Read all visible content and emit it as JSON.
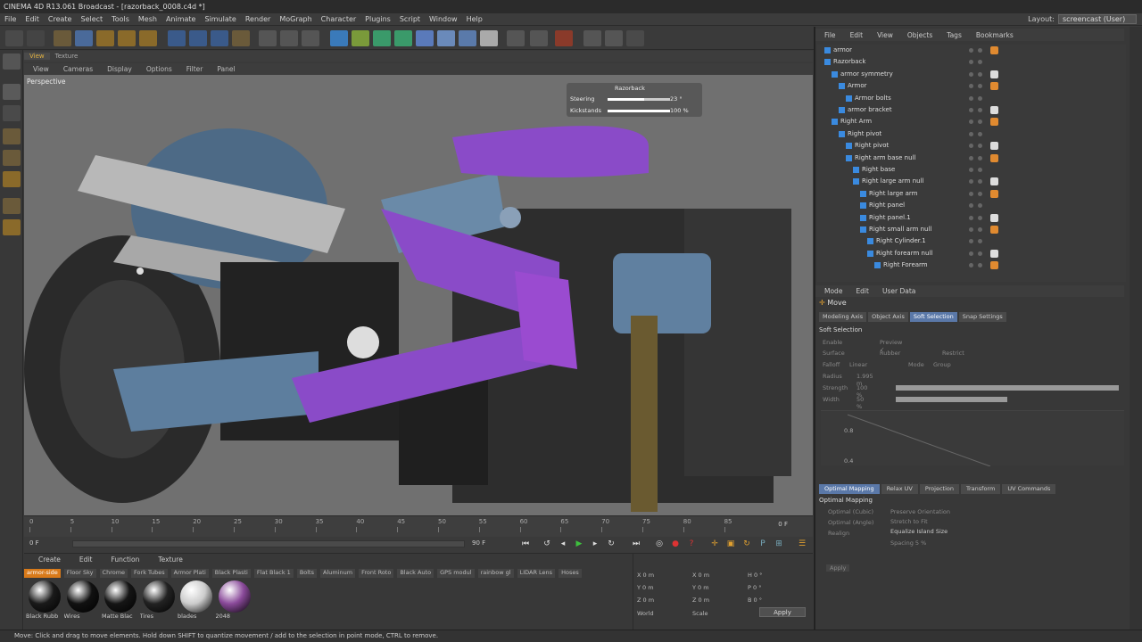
{
  "app": {
    "title": "CINEMA 4D R13.061 Broadcast - [razorback_0008.c4d *]"
  },
  "menubar": [
    "File",
    "Edit",
    "Create",
    "Select",
    "Tools",
    "Mesh",
    "Animate",
    "Simulate",
    "Render",
    "MoGraph",
    "Character",
    "Plugins",
    "Script",
    "Window",
    "Help"
  ],
  "layout": {
    "label": "Layout:",
    "value": "screencast (User)"
  },
  "viewport": {
    "tabs": [
      "View",
      "Texture"
    ],
    "menu": [
      "View",
      "Cameras",
      "Display",
      "Options",
      "Filter",
      "Panel"
    ],
    "label": "Perspective",
    "hud": {
      "name": "Razorback",
      "rows": [
        {
          "label": "Steering",
          "value": "23 °",
          "fill": 0.58
        },
        {
          "label": "Kickstands",
          "value": "100 %",
          "fill": 1.0
        }
      ]
    }
  },
  "timeline": {
    "ticks": [
      "0",
      "5",
      "10",
      "15",
      "20",
      "25",
      "30",
      "35",
      "40",
      "45",
      "50",
      "55",
      "60",
      "65",
      "70",
      "75",
      "80",
      "85"
    ],
    "current": "0 F",
    "start": "0 F",
    "end": "90 F"
  },
  "materials": {
    "menu": [
      "Create",
      "Edit",
      "Function",
      "Texture"
    ],
    "tabs": [
      "armor-side",
      "Floor Sky",
      "Chrome",
      "Fork Tubes",
      "Armor Plati",
      "Black Plasti",
      "Flat Black 1",
      "Bolts",
      "Aluminum",
      "Front Roto",
      "Black Auto",
      "GPS modul",
      "rainbow gl",
      "LIDAR Lens",
      "Hoses"
    ],
    "active_tab": "armor-side",
    "items": [
      {
        "label": "Black Rubb",
        "color": "#1a1a1a"
      },
      {
        "label": "Wires",
        "color": "#111111"
      },
      {
        "label": "Matte Blac",
        "color": "#151515"
      },
      {
        "label": "Tires",
        "color": "#222222"
      },
      {
        "label": "blades",
        "color": "#cccccc"
      },
      {
        "label": "2048",
        "color": "#8a4a9a"
      }
    ]
  },
  "coords": {
    "rows": [
      [
        "X  0 m",
        "X  0 m",
        "H  0 °"
      ],
      [
        "Y  0 m",
        "Y  0 m",
        "P  0 °"
      ],
      [
        "Z  0 m",
        "Z  0 m",
        "B  0 °"
      ]
    ],
    "dropdowns": [
      "World",
      "Scale"
    ],
    "apply": "Apply"
  },
  "objects": {
    "menu": [
      "File",
      "Edit",
      "View",
      "Objects",
      "Tags",
      "Bookmarks"
    ],
    "rows": [
      {
        "name": "armor",
        "indent": 0
      },
      {
        "name": "Razorback",
        "indent": 0
      },
      {
        "name": "armor symmetry",
        "indent": 1
      },
      {
        "name": "Armor",
        "indent": 2
      },
      {
        "name": "Armor bolts",
        "indent": 3
      },
      {
        "name": "armor bracket",
        "indent": 2
      },
      {
        "name": "Right Arm",
        "indent": 1
      },
      {
        "name": "Right pivot",
        "indent": 2
      },
      {
        "name": "Right pivot",
        "indent": 3
      },
      {
        "name": "Right arm base null",
        "indent": 3
      },
      {
        "name": "Right base",
        "indent": 4
      },
      {
        "name": "Right large arm null",
        "indent": 4
      },
      {
        "name": "Right large arm",
        "indent": 5
      },
      {
        "name": "Right panel",
        "indent": 5
      },
      {
        "name": "Right panel.1",
        "indent": 5
      },
      {
        "name": "Right small arm null",
        "indent": 5
      },
      {
        "name": "Right Cylinder.1",
        "indent": 6
      },
      {
        "name": "Right forearm null",
        "indent": 6
      },
      {
        "name": "Right Forearm",
        "indent": 7
      }
    ]
  },
  "attributes": {
    "menu": [
      "Mode",
      "Edit",
      "User Data"
    ],
    "title": "Move",
    "tabs": [
      "Modeling Axis",
      "Object Axis",
      "Soft Selection",
      "Snap Settings"
    ],
    "active_tab": "Soft Selection",
    "section": "Soft Selection",
    "fields": [
      {
        "label": "Enable",
        "extra": "Preview ✓"
      },
      {
        "label": "Surface",
        "extra": "Rubber",
        "extra2": "Restrict"
      },
      {
        "label": "Falloff",
        "value": "Linear",
        "extra": "Mode",
        "extra_value": "Group"
      },
      {
        "label": "Radius",
        "value": "1.995 m"
      },
      {
        "label": "Strength",
        "value": "100 %"
      },
      {
        "label": "Width",
        "value": "50 %"
      }
    ],
    "strength_fill": 1.0,
    "width_fill": 0.5,
    "graph_labels": [
      "0.8",
      "0.4"
    ]
  },
  "uv": {
    "tabs": [
      "Optimal Mapping",
      "Relax UV",
      "Projection",
      "Transform",
      "UV Commands"
    ],
    "active_tab": "Optimal Mapping",
    "section": "Optimal Mapping",
    "left": [
      "Optimal (Cubic)",
      "Optimal (Angle)",
      "Realign"
    ],
    "right": [
      "Preserve Orientation",
      "Stretch to Fit",
      "Equalize Island Size",
      "Spacing  5 %"
    ],
    "apply": "Apply"
  },
  "status": "Move: Click and drag to move elements. Hold down SHIFT to quantize movement / add to the selection in point mode, CTRL to remove."
}
